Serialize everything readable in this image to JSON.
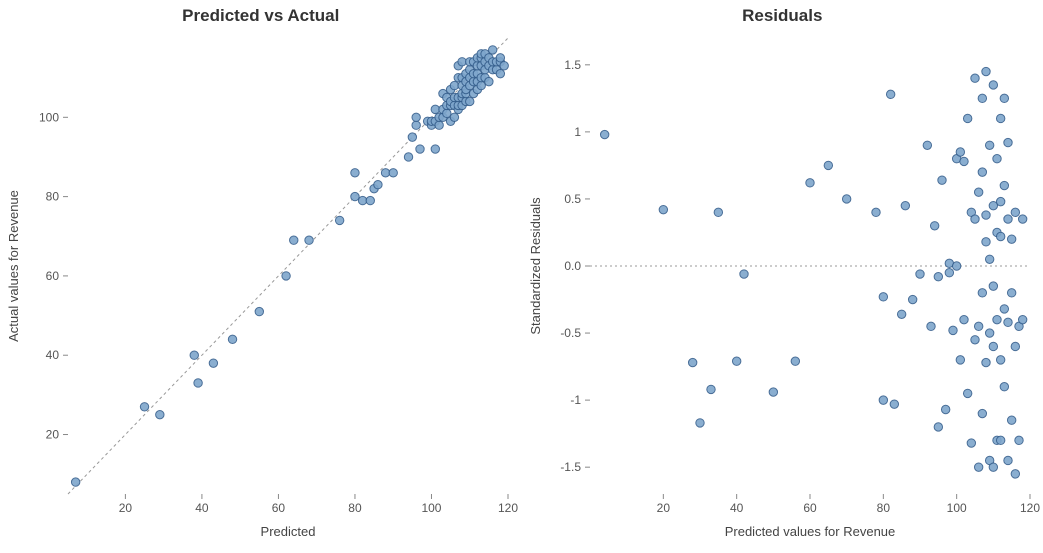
{
  "chart_data": [
    {
      "type": "scatter",
      "title": "Predicted vs Actual",
      "xlabel": "Predicted",
      "ylabel": "Actual values for Revenue",
      "xlim": [
        5,
        120
      ],
      "ylim": [
        5,
        120
      ],
      "x_ticks": [
        20,
        40,
        60,
        80,
        100,
        120
      ],
      "y_ticks": [
        20,
        40,
        60,
        80,
        100
      ],
      "reference_line": "y=x",
      "points": [
        {
          "x": 7,
          "y": 8
        },
        {
          "x": 25,
          "y": 27
        },
        {
          "x": 29,
          "y": 25
        },
        {
          "x": 38,
          "y": 40
        },
        {
          "x": 39,
          "y": 33
        },
        {
          "x": 43,
          "y": 38
        },
        {
          "x": 48,
          "y": 44
        },
        {
          "x": 55,
          "y": 51
        },
        {
          "x": 62,
          "y": 60
        },
        {
          "x": 64,
          "y": 69
        },
        {
          "x": 68,
          "y": 69
        },
        {
          "x": 76,
          "y": 74
        },
        {
          "x": 80,
          "y": 80
        },
        {
          "x": 80,
          "y": 86
        },
        {
          "x": 82,
          "y": 79
        },
        {
          "x": 84,
          "y": 79
        },
        {
          "x": 85,
          "y": 82
        },
        {
          "x": 86,
          "y": 83
        },
        {
          "x": 88,
          "y": 86
        },
        {
          "x": 90,
          "y": 86
        },
        {
          "x": 94,
          "y": 90
        },
        {
          "x": 95,
          "y": 95
        },
        {
          "x": 96,
          "y": 98
        },
        {
          "x": 96,
          "y": 100
        },
        {
          "x": 97,
          "y": 92
        },
        {
          "x": 99,
          "y": 99
        },
        {
          "x": 100,
          "y": 98
        },
        {
          "x": 100,
          "y": 99
        },
        {
          "x": 101,
          "y": 92
        },
        {
          "x": 101,
          "y": 99
        },
        {
          "x": 101,
          "y": 102
        },
        {
          "x": 102,
          "y": 98
        },
        {
          "x": 102,
          "y": 100
        },
        {
          "x": 103,
          "y": 100
        },
        {
          "x": 103,
          "y": 102
        },
        {
          "x": 103,
          "y": 106
        },
        {
          "x": 104,
          "y": 101
        },
        {
          "x": 104,
          "y": 103
        },
        {
          "x": 104,
          "y": 105
        },
        {
          "x": 105,
          "y": 99
        },
        {
          "x": 105,
          "y": 103
        },
        {
          "x": 105,
          "y": 104
        },
        {
          "x": 105,
          "y": 107
        },
        {
          "x": 106,
          "y": 100
        },
        {
          "x": 106,
          "y": 103
        },
        {
          "x": 106,
          "y": 105
        },
        {
          "x": 106,
          "y": 108
        },
        {
          "x": 107,
          "y": 102
        },
        {
          "x": 107,
          "y": 103
        },
        {
          "x": 107,
          "y": 105
        },
        {
          "x": 107,
          "y": 110
        },
        {
          "x": 107,
          "y": 113
        },
        {
          "x": 108,
          "y": 103
        },
        {
          "x": 108,
          "y": 105
        },
        {
          "x": 108,
          "y": 106
        },
        {
          "x": 108,
          "y": 108
        },
        {
          "x": 108,
          "y": 110
        },
        {
          "x": 108,
          "y": 114
        },
        {
          "x": 109,
          "y": 104
        },
        {
          "x": 109,
          "y": 106
        },
        {
          "x": 109,
          "y": 107
        },
        {
          "x": 109,
          "y": 109
        },
        {
          "x": 109,
          "y": 111
        },
        {
          "x": 110,
          "y": 104
        },
        {
          "x": 110,
          "y": 108
        },
        {
          "x": 110,
          "y": 110
        },
        {
          "x": 110,
          "y": 112
        },
        {
          "x": 110,
          "y": 114
        },
        {
          "x": 111,
          "y": 106
        },
        {
          "x": 111,
          "y": 109
        },
        {
          "x": 111,
          "y": 111
        },
        {
          "x": 111,
          "y": 114
        },
        {
          "x": 112,
          "y": 107
        },
        {
          "x": 112,
          "y": 109
        },
        {
          "x": 112,
          "y": 111
        },
        {
          "x": 112,
          "y": 113
        },
        {
          "x": 112,
          "y": 115
        },
        {
          "x": 113,
          "y": 108
        },
        {
          "x": 113,
          "y": 110
        },
        {
          "x": 113,
          "y": 113
        },
        {
          "x": 113,
          "y": 115
        },
        {
          "x": 113,
          "y": 116
        },
        {
          "x": 114,
          "y": 110
        },
        {
          "x": 114,
          "y": 112
        },
        {
          "x": 114,
          "y": 114
        },
        {
          "x": 114,
          "y": 116
        },
        {
          "x": 115,
          "y": 109
        },
        {
          "x": 115,
          "y": 113
        },
        {
          "x": 115,
          "y": 115
        },
        {
          "x": 116,
          "y": 112
        },
        {
          "x": 116,
          "y": 114
        },
        {
          "x": 116,
          "y": 117
        },
        {
          "x": 117,
          "y": 112
        },
        {
          "x": 117,
          "y": 114
        },
        {
          "x": 118,
          "y": 111
        },
        {
          "x": 118,
          "y": 114
        },
        {
          "x": 118,
          "y": 115
        },
        {
          "x": 119,
          "y": 113
        }
      ]
    },
    {
      "type": "scatter",
      "title": "Residuals",
      "xlabel": "Predicted values for Revenue",
      "ylabel": "Standardized Residuals",
      "xlim": [
        0,
        120
      ],
      "ylim": [
        -1.7,
        1.7
      ],
      "x_ticks": [
        20,
        40,
        60,
        80,
        100,
        120
      ],
      "y_ticks": [
        -1.5,
        -1.0,
        -0.5,
        0.0,
        0.5,
        1.0,
        1.5
      ],
      "reference_line": "y=0",
      "points": [
        {
          "x": 4,
          "y": 0.98
        },
        {
          "x": 20,
          "y": 0.42
        },
        {
          "x": 28,
          "y": -0.72
        },
        {
          "x": 30,
          "y": -1.17
        },
        {
          "x": 33,
          "y": -0.92
        },
        {
          "x": 35,
          "y": 0.4
        },
        {
          "x": 40,
          "y": -0.71
        },
        {
          "x": 42,
          "y": -0.06
        },
        {
          "x": 50,
          "y": -0.94
        },
        {
          "x": 56,
          "y": -0.71
        },
        {
          "x": 60,
          "y": 0.62
        },
        {
          "x": 65,
          "y": 0.75
        },
        {
          "x": 70,
          "y": 0.5
        },
        {
          "x": 78,
          "y": 0.4
        },
        {
          "x": 80,
          "y": -0.23
        },
        {
          "x": 80,
          "y": -1.0
        },
        {
          "x": 82,
          "y": 1.28
        },
        {
          "x": 83,
          "y": -1.03
        },
        {
          "x": 85,
          "y": -0.36
        },
        {
          "x": 86,
          "y": 0.45
        },
        {
          "x": 88,
          "y": -0.25
        },
        {
          "x": 90,
          "y": -0.06
        },
        {
          "x": 92,
          "y": 0.9
        },
        {
          "x": 93,
          "y": -0.45
        },
        {
          "x": 94,
          "y": 0.3
        },
        {
          "x": 95,
          "y": -0.08
        },
        {
          "x": 95,
          "y": -1.2
        },
        {
          "x": 96,
          "y": 0.64
        },
        {
          "x": 97,
          "y": -1.07
        },
        {
          "x": 98,
          "y": -0.05
        },
        {
          "x": 98,
          "y": 0.02
        },
        {
          "x": 99,
          "y": -0.48
        },
        {
          "x": 100,
          "y": 0.0
        },
        {
          "x": 100,
          "y": 0.8
        },
        {
          "x": 101,
          "y": -0.7
        },
        {
          "x": 101,
          "y": 0.85
        },
        {
          "x": 102,
          "y": 0.78
        },
        {
          "x": 102,
          "y": -0.4
        },
        {
          "x": 103,
          "y": 1.1
        },
        {
          "x": 103,
          "y": -0.95
        },
        {
          "x": 104,
          "y": 0.4
        },
        {
          "x": 104,
          "y": -1.32
        },
        {
          "x": 105,
          "y": 0.35
        },
        {
          "x": 105,
          "y": 1.4
        },
        {
          "x": 105,
          "y": -0.55
        },
        {
          "x": 106,
          "y": -0.45
        },
        {
          "x": 106,
          "y": 0.55
        },
        {
          "x": 106,
          "y": -1.5
        },
        {
          "x": 107,
          "y": 0.7
        },
        {
          "x": 107,
          "y": -0.2
        },
        {
          "x": 107,
          "y": 1.25
        },
        {
          "x": 107,
          "y": -1.1
        },
        {
          "x": 108,
          "y": 0.38
        },
        {
          "x": 108,
          "y": -0.72
        },
        {
          "x": 108,
          "y": 1.45
        },
        {
          "x": 108,
          "y": 0.18
        },
        {
          "x": 109,
          "y": -0.5
        },
        {
          "x": 109,
          "y": -1.45
        },
        {
          "x": 109,
          "y": 0.9
        },
        {
          "x": 109,
          "y": 0.05
        },
        {
          "x": 110,
          "y": 0.45
        },
        {
          "x": 110,
          "y": 1.35
        },
        {
          "x": 110,
          "y": -0.6
        },
        {
          "x": 110,
          "y": -1.5
        },
        {
          "x": 110,
          "y": -0.15
        },
        {
          "x": 111,
          "y": 0.8
        },
        {
          "x": 111,
          "y": -0.4
        },
        {
          "x": 111,
          "y": -1.3
        },
        {
          "x": 111,
          "y": 0.25
        },
        {
          "x": 112,
          "y": 1.1
        },
        {
          "x": 112,
          "y": -0.7
        },
        {
          "x": 112,
          "y": 0.48
        },
        {
          "x": 112,
          "y": -1.3
        },
        {
          "x": 112,
          "y": 0.22
        },
        {
          "x": 113,
          "y": -0.32
        },
        {
          "x": 113,
          "y": 0.6
        },
        {
          "x": 113,
          "y": 1.25
        },
        {
          "x": 113,
          "y": -0.9
        },
        {
          "x": 114,
          "y": -0.42
        },
        {
          "x": 114,
          "y": 0.92
        },
        {
          "x": 114,
          "y": -1.45
        },
        {
          "x": 114,
          "y": 0.35
        },
        {
          "x": 115,
          "y": -0.2
        },
        {
          "x": 115,
          "y": 0.2
        },
        {
          "x": 115,
          "y": -1.15
        },
        {
          "x": 116,
          "y": 0.4
        },
        {
          "x": 116,
          "y": -0.6
        },
        {
          "x": 116,
          "y": -1.55
        },
        {
          "x": 117,
          "y": -0.45
        },
        {
          "x": 117,
          "y": -1.3
        },
        {
          "x": 118,
          "y": 0.35
        },
        {
          "x": 118,
          "y": -0.4
        }
      ]
    }
  ]
}
